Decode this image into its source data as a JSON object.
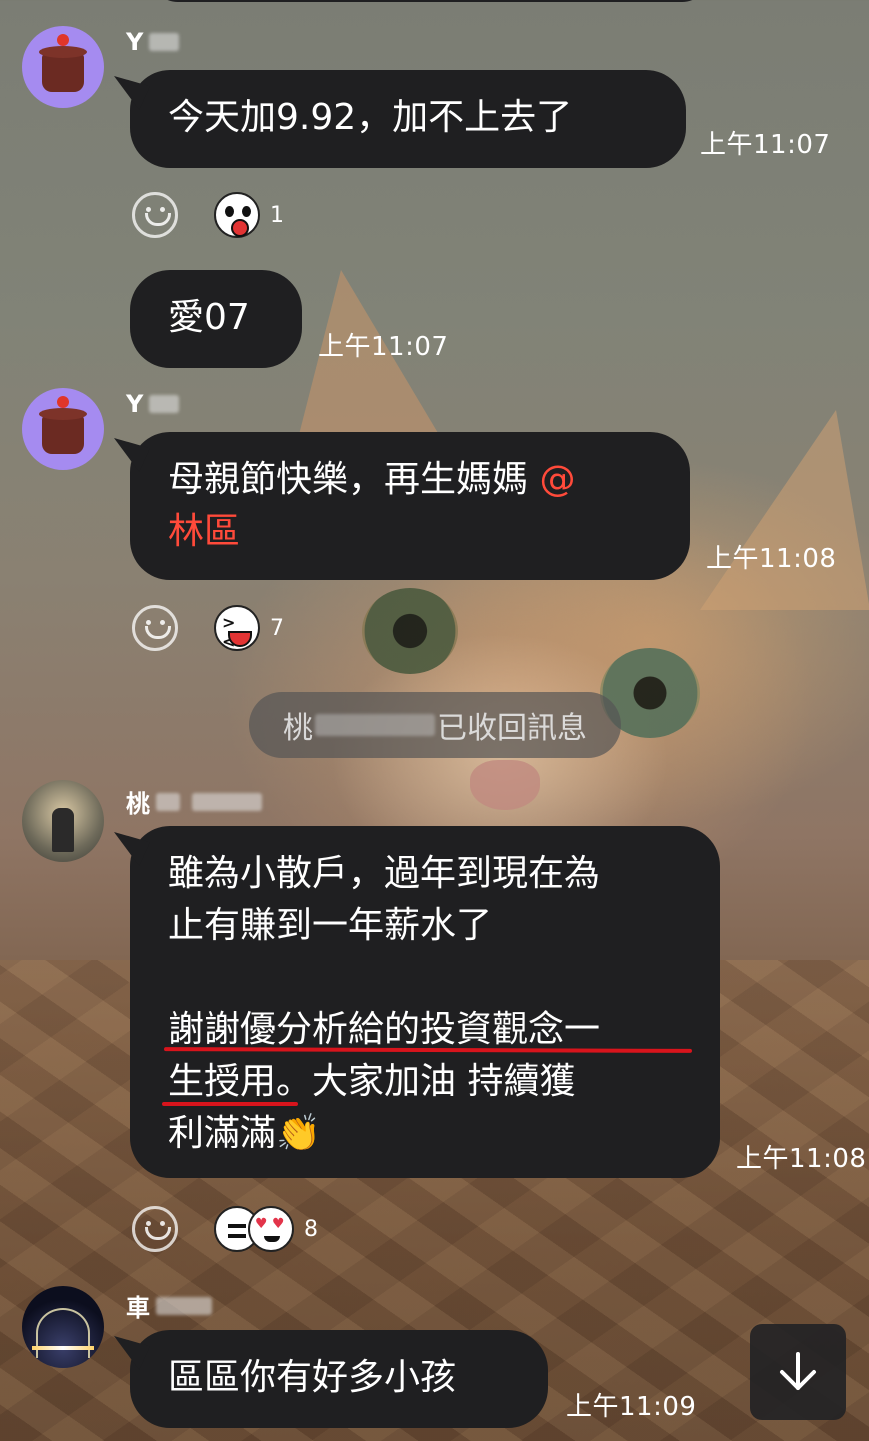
{
  "messages": [
    {
      "sender": "Y",
      "text": "今天加9.92，加不上去了",
      "time": "上午11:07",
      "reactions": {
        "count": "1"
      }
    },
    {
      "text": "愛07",
      "time": "上午11:07"
    },
    {
      "sender": "Y",
      "text": "母親節快樂，再生媽媽 ",
      "mention": "@林區",
      "mention_part1": "@",
      "mention_part2": "林區",
      "time": "上午11:08",
      "reactions": {
        "count": "7"
      }
    },
    {
      "sender": "桃",
      "line1": "雖為小散戶，過年到現在為",
      "line2": "止有賺到一年薪水了",
      "line3": "謝謝優分析給的投資觀念一",
      "line4a": "生授用",
      "line4b": "。大家加油 持續獲",
      "line5": "利滿滿",
      "emoji": "👏",
      "time": "上午11:08",
      "reactions": {
        "count": "8"
      }
    },
    {
      "sender": "車",
      "text": "區區你有好多小孩",
      "time": "上午11:09"
    }
  ],
  "system": {
    "prefix": "桃",
    "suffix": "已收回訊息"
  },
  "colors": {
    "bubble": "#1f1f21",
    "mention": "#ff4a3a",
    "underline": "#d8141c",
    "avatar_bg": "#a58bf0"
  },
  "icons": {
    "reaction_add": "smile-outline-icon",
    "scroll_down": "arrow-down-icon"
  }
}
